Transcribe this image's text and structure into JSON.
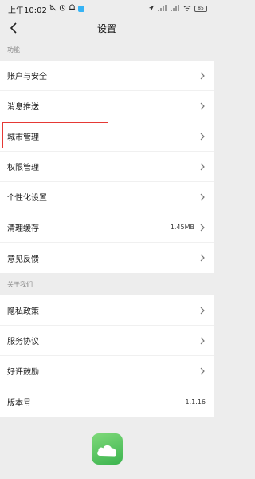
{
  "status_bar": {
    "time": "上午10:02",
    "icons": [
      "mute-icon",
      "alarm-icon",
      "notification-icon",
      "app-icon"
    ],
    "right_icons": [
      "location-icon",
      "signal-icon",
      "signal-icon",
      "wifi-icon",
      "battery-icon"
    ],
    "battery": "85"
  },
  "header": {
    "title": "设置",
    "back_icon": "chevron-left-icon"
  },
  "sections": {
    "functions": {
      "label": "功能",
      "items": [
        {
          "label": "账户与安全"
        },
        {
          "label": "消息推送"
        },
        {
          "label": "城市管理"
        },
        {
          "label": "权限管理"
        },
        {
          "label": "个性化设置"
        },
        {
          "label": "清理缓存",
          "value": "1.45MB"
        },
        {
          "label": "意见反馈"
        }
      ]
    },
    "about": {
      "label": "关于我们",
      "items": [
        {
          "label": "隐私政策"
        },
        {
          "label": "服务协议"
        },
        {
          "label": "好评鼓励"
        },
        {
          "label": "版本号",
          "value": "1.1.16"
        }
      ]
    }
  },
  "colors": {
    "background": "#ededed",
    "highlight": "#e53935",
    "logo": "#3cb44f"
  }
}
